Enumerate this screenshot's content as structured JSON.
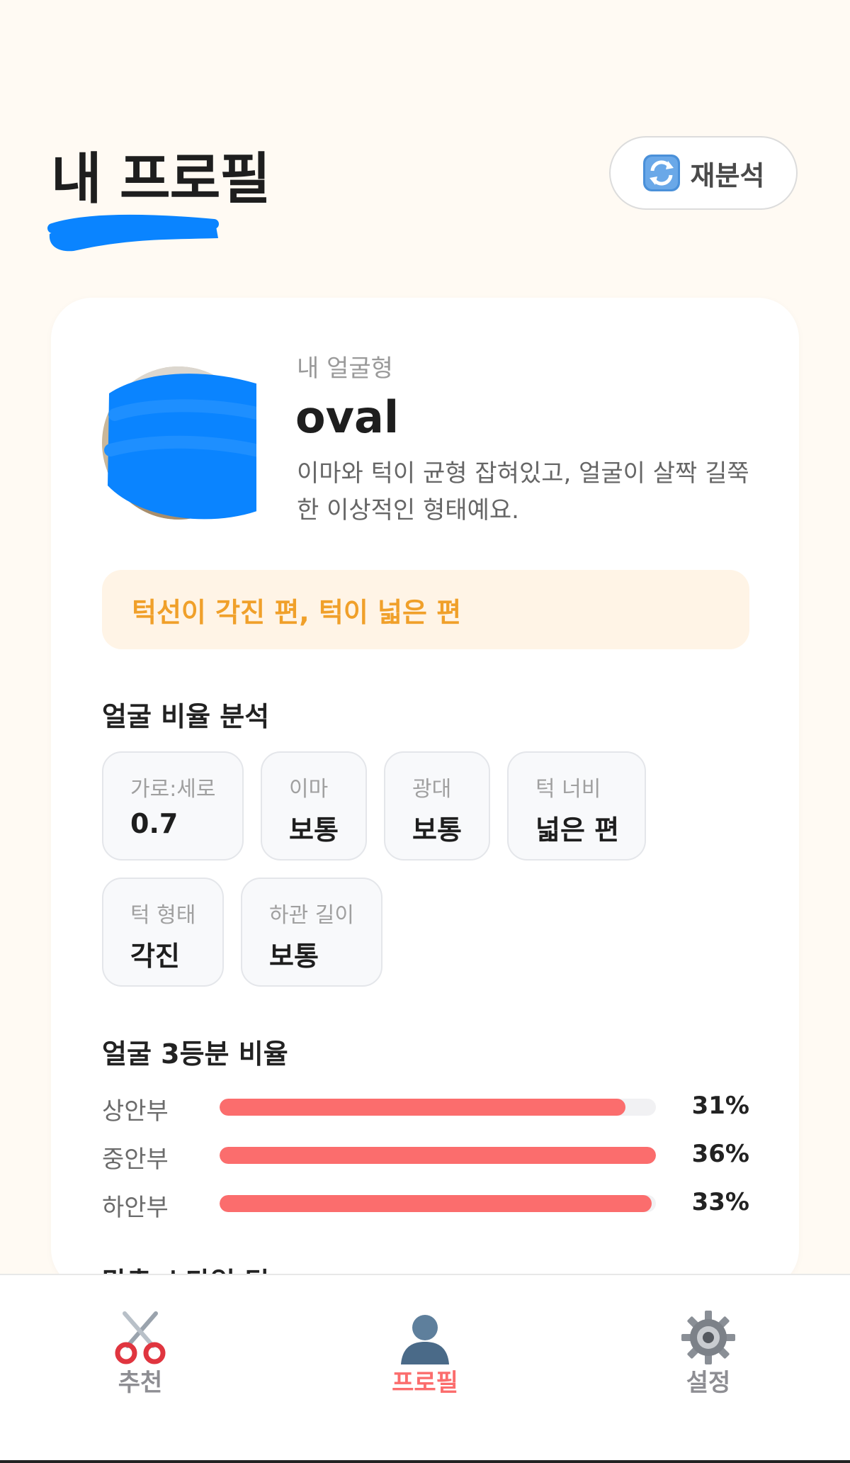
{
  "header": {
    "title": "내 프로필",
    "reanalyze_label": "재분석",
    "reanalyze_icon": "refresh-icon"
  },
  "profile": {
    "shape_label": "내 얼굴형",
    "shape_name": "oval",
    "shape_description": "이마와 턱이 균형 잡혀있고, 얼굴이 살짝 길쭉한 이상적인 형태예요.",
    "trait_banner": "턱선이 각진 편, 턱이 넓은 편"
  },
  "ratio_analysis": {
    "title": "얼굴 비율 분석",
    "metrics": [
      {
        "label": "가로:세로",
        "value": "0.7"
      },
      {
        "label": "이마",
        "value": "보통"
      },
      {
        "label": "광대",
        "value": "보통"
      },
      {
        "label": "턱 너비",
        "value": "넓은 편"
      },
      {
        "label": "턱 형태",
        "value": "각진"
      },
      {
        "label": "하관 길이",
        "value": "보통"
      }
    ]
  },
  "thirds": {
    "title": "얼굴 3등분 비율",
    "rows": [
      {
        "label": "상안부",
        "value": "31%",
        "fill": 0.93
      },
      {
        "label": "중안부",
        "value": "36%",
        "fill": 1.0
      },
      {
        "label": "하안부",
        "value": "33%",
        "fill": 0.99
      }
    ]
  },
  "next_section_title": "맞춤 스타일 팁",
  "tabbar": {
    "tabs": [
      {
        "label": "추천",
        "icon": "scissors-icon"
      },
      {
        "label": "프로필",
        "icon": "person-icon"
      },
      {
        "label": "설정",
        "icon": "gear-icon"
      }
    ],
    "active_color": "#fb6d6d"
  },
  "colors": {
    "accent": "#fb6d6d",
    "trait_text": "#f0a02a",
    "trait_bg": "#fff4e6",
    "page_bg": "#fffaf3"
  }
}
